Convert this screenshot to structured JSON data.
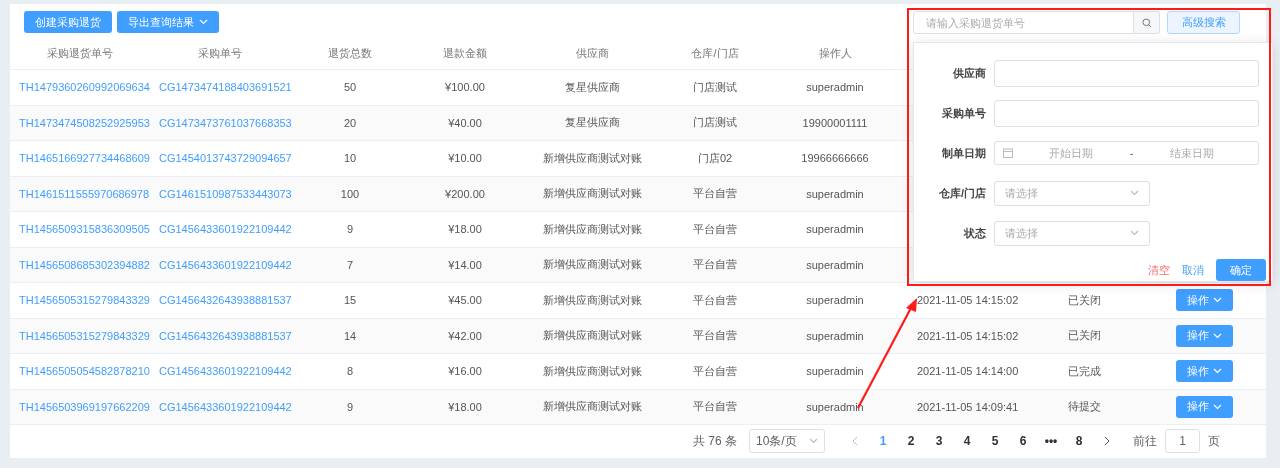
{
  "toolbar": {
    "buttons": [
      {
        "label": "创建采购退货",
        "kind": "plain"
      },
      {
        "label": "导出查询结果",
        "kind": "dropdown"
      }
    ]
  },
  "search": {
    "placeholder": "请输入采购退货单号",
    "advanced_button": "高级搜索"
  },
  "table": {
    "columns": [
      "采购退货单号",
      "采购单号",
      "退货总数",
      "退款金额",
      "供应商",
      "仓库/门店",
      "操作人"
    ],
    "rows": [
      {
        "return_no": "TH1479360260992069634",
        "purchase_no": "CG1473474188403691521",
        "qty": "50",
        "amount": "¥100.00",
        "supplier": "复星供应商",
        "store": "门店测试",
        "operator": "superadmin"
      },
      {
        "return_no": "TH1473474508252925953",
        "purchase_no": "CG1473473761037668353",
        "qty": "20",
        "amount": "¥40.00",
        "supplier": "复星供应商",
        "store": "门店测试",
        "operator": "19900001111"
      },
      {
        "return_no": "TH1465166927734468609",
        "purchase_no": "CG1454013743729094657",
        "qty": "10",
        "amount": "¥10.00",
        "supplier": "新增供应商测试对账",
        "store": "门店02",
        "operator": "19966666666"
      },
      {
        "return_no": "TH1461511555970686978",
        "purchase_no": "CG1461510987533443073",
        "qty": "100",
        "amount": "¥200.00",
        "supplier": "新增供应商测试对账",
        "store": "平台自营",
        "operator": "superadmin"
      },
      {
        "return_no": "TH1456509315836309505",
        "purchase_no": "CG1456433601922109442",
        "qty": "9",
        "amount": "¥18.00",
        "supplier": "新增供应商测试对账",
        "store": "平台自营",
        "operator": "superadmin"
      },
      {
        "return_no": "TH1456508685302394882",
        "purchase_no": "CG1456433601922109442",
        "qty": "7",
        "amount": "¥14.00",
        "supplier": "新增供应商测试对账",
        "store": "平台自营",
        "operator": "superadmin"
      },
      {
        "return_no": "TH1456505315279843329",
        "purchase_no": "CG1456432643938881537",
        "qty": "15",
        "amount": "¥45.00",
        "supplier": "新增供应商测试对账",
        "store": "平台自营",
        "operator": "superadmin",
        "date": "2021-11-05 14:15:02",
        "status": "已关闭",
        "action": "操作"
      },
      {
        "return_no": "TH1456505315279843329",
        "purchase_no": "CG1456432643938881537",
        "qty": "14",
        "amount": "¥42.00",
        "supplier": "新增供应商测试对账",
        "store": "平台自营",
        "operator": "superadmin",
        "date": "2021-11-05 14:15:02",
        "status": "已关闭",
        "action": "操作"
      },
      {
        "return_no": "TH1456505054582878210",
        "purchase_no": "CG1456433601922109442",
        "qty": "8",
        "amount": "¥16.00",
        "supplier": "新增供应商测试对账",
        "store": "平台自营",
        "operator": "superadmin",
        "date": "2021-11-05 14:14:00",
        "status": "已完成",
        "action": "操作"
      },
      {
        "return_no": "TH1456503969197662209",
        "purchase_no": "CG1456433601922109442",
        "qty": "9",
        "amount": "¥18.00",
        "supplier": "新增供应商测试对账",
        "store": "平台自营",
        "operator": "superadmin",
        "date": "2021-11-05 14:09:41",
        "status": "待提交",
        "action": "操作"
      }
    ]
  },
  "advanced_search": {
    "fields": [
      {
        "label": "供应商",
        "kind": "text"
      },
      {
        "label": "采购单号",
        "kind": "text"
      },
      {
        "label": "制单日期",
        "kind": "daterange",
        "start_placeholder": "开始日期",
        "separator": "-",
        "end_placeholder": "结束日期"
      },
      {
        "label": "仓库/门店",
        "kind": "select",
        "placeholder": "请选择"
      },
      {
        "label": "状态",
        "kind": "select",
        "placeholder": "请选择"
      }
    ],
    "actions": [
      {
        "label": "清空",
        "kind": "danger"
      },
      {
        "label": "取消",
        "kind": "link"
      },
      {
        "label": "确定",
        "kind": "primary"
      }
    ]
  },
  "pagination": {
    "total": "共 76 条",
    "page_size": "10条/页",
    "pages": [
      {
        "label": "1",
        "selected": true
      },
      {
        "label": "2",
        "selected": false
      },
      {
        "label": "3",
        "selected": false
      },
      {
        "label": "4",
        "selected": false
      },
      {
        "label": "5",
        "selected": false
      },
      {
        "label": "6",
        "selected": false
      },
      {
        "label": "•••",
        "selected": false
      },
      {
        "label": "8",
        "selected": false
      }
    ],
    "goto_label": "前往",
    "goto_value": "1",
    "goto_suffix": "页"
  }
}
